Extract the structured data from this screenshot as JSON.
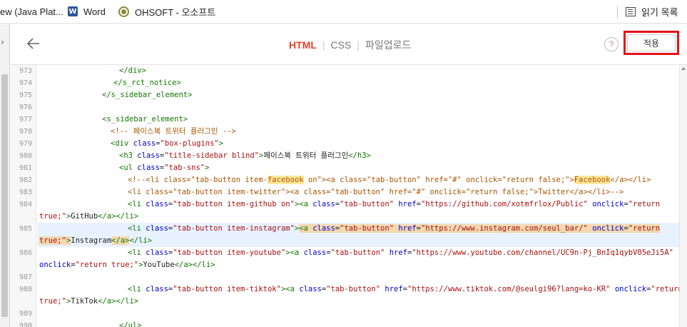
{
  "bookmarks": {
    "items": [
      {
        "label": "ew (Java Plat..."
      },
      {
        "label": "Word",
        "icon": "word-icon"
      },
      {
        "label": "OHSOFT - 오소프트",
        "icon": "ohsoft-icon"
      }
    ],
    "reading_list": "읽기 목록"
  },
  "header": {
    "tabs": [
      {
        "label": "HTML",
        "active": true
      },
      {
        "label": "CSS",
        "active": false
      },
      {
        "label": "파일업로드",
        "active": false
      }
    ],
    "help": "?",
    "apply_label": "적용"
  },
  "editor": {
    "lines": [
      {
        "num": "973",
        "segments": [
          {
            "text": "</div>",
            "cls": "t"
          }
        ]
      },
      {
        "num": "974",
        "segments": [
          {
            "text": "</s_rct_notice>",
            "cls": "t"
          }
        ]
      },
      {
        "num": "975",
        "segments": [
          {
            "text": "</s_sidebar_element>",
            "cls": "t"
          }
        ]
      },
      {
        "num": "976",
        "segments": []
      },
      {
        "num": "977",
        "segments": [
          {
            "text": "<s_sidebar_element>",
            "cls": "t"
          }
        ]
      },
      {
        "num": "978",
        "segments": [
          {
            "text": "<!-- 페이스북 트위터 플러그인 -->",
            "cls": "c"
          }
        ]
      },
      {
        "num": "979",
        "segments": [
          {
            "text": "<div ",
            "cls": "t"
          },
          {
            "text": "class",
            "cls": "a"
          },
          {
            "text": "=",
            "cls": ""
          },
          {
            "text": "\"box-plugins\"",
            "cls": "s"
          },
          {
            "text": ">",
            "cls": "t"
          }
        ]
      },
      {
        "num": "980",
        "segments": [
          {
            "text": "<h3 ",
            "cls": "t"
          },
          {
            "text": "class",
            "cls": "a"
          },
          {
            "text": "=",
            "cls": ""
          },
          {
            "text": "\"title-sidebar blind\"",
            "cls": "s"
          },
          {
            "text": ">",
            "cls": "t"
          },
          {
            "text": "페이스북 트위터 플러그인",
            "cls": ""
          },
          {
            "text": "</h3>",
            "cls": "t"
          }
        ]
      },
      {
        "num": "981",
        "segments": [
          {
            "text": "<ul ",
            "cls": "t"
          },
          {
            "text": "class",
            "cls": "a"
          },
          {
            "text": "=",
            "cls": ""
          },
          {
            "text": "\"tab-sns\"",
            "cls": "s"
          },
          {
            "text": ">",
            "cls": "t"
          }
        ]
      },
      {
        "num": "982",
        "segments": [
          {
            "text": "<!--<li class=\"tab-button item-",
            "cls": "c"
          },
          {
            "text": "facebook",
            "cls": "c m"
          },
          {
            "text": " on\"><a class=\"tab-button\" href=\"#\" onclick=\"return false;\">",
            "cls": "c"
          },
          {
            "text": "Facebook",
            "cls": "c m"
          },
          {
            "text": "</a></li>",
            "cls": "c"
          }
        ]
      },
      {
        "num": "983",
        "segments": [
          {
            "text": "<li class=\"tab-button item-twitter\"><a class=\"tab-button\" href=\"#\" onclick=\"return false;\">Twitter</a></li>-->",
            "cls": "c"
          }
        ]
      },
      {
        "num": "984",
        "segments": [
          {
            "text": "<li ",
            "cls": "t"
          },
          {
            "text": "class",
            "cls": "a"
          },
          {
            "text": "=",
            "cls": ""
          },
          {
            "text": "\"tab-button item-github on\"",
            "cls": "s"
          },
          {
            "text": "><a ",
            "cls": "t"
          },
          {
            "text": "class",
            "cls": "a"
          },
          {
            "text": "=",
            "cls": ""
          },
          {
            "text": "\"tab-button\"",
            "cls": "s"
          },
          {
            "text": " ",
            "cls": ""
          },
          {
            "text": "href",
            "cls": "a"
          },
          {
            "text": "=",
            "cls": ""
          },
          {
            "text": "\"https://github.com/xotmfrlox/Public\"",
            "cls": "s"
          },
          {
            "text": " ",
            "cls": ""
          },
          {
            "text": "onclick",
            "cls": "a"
          },
          {
            "text": "=",
            "cls": ""
          },
          {
            "text": "\"return",
            "cls": "s"
          }
        ]
      },
      {
        "num": "",
        "segments": [
          {
            "text": "true;\"",
            "cls": "s"
          },
          {
            "text": ">",
            "cls": "t"
          },
          {
            "text": "GitHub",
            "cls": ""
          },
          {
            "text": "</a></li>",
            "cls": "t"
          }
        ]
      },
      {
        "num": "985",
        "segments": [
          {
            "text": "<li ",
            "cls": "t"
          },
          {
            "text": "class",
            "cls": "a"
          },
          {
            "text": "=",
            "cls": ""
          },
          {
            "text": "\"tab-button item-instagram\"",
            "cls": "s"
          },
          {
            "text": ">",
            "cls": "t"
          },
          {
            "text": "<a ",
            "cls": "t mb"
          },
          {
            "text": "class",
            "cls": "a mb"
          },
          {
            "text": "=",
            "cls": "mb"
          },
          {
            "text": "\"tab-button\"",
            "cls": "s mb"
          },
          {
            "text": " ",
            "cls": "mb"
          },
          {
            "text": "href",
            "cls": "a mb"
          },
          {
            "text": "=",
            "cls": "mb"
          },
          {
            "text": "\"https://www.instagram.com/seul_bar/\"",
            "cls": "s mb"
          },
          {
            "text": " ",
            "cls": "mb"
          },
          {
            "text": "onclick",
            "cls": "a mb"
          },
          {
            "text": "=",
            "cls": "mb"
          },
          {
            "text": "\"return",
            "cls": "s mb"
          }
        ]
      },
      {
        "num": "",
        "segments": [
          {
            "text": "true;\"",
            "cls": "s mb"
          },
          {
            "text": ">",
            "cls": "t mb"
          },
          {
            "text": "Instagram",
            "cls": ""
          },
          {
            "text": "</a>",
            "cls": "t mb"
          },
          {
            "text": "</li>",
            "cls": "t"
          }
        ]
      },
      {
        "num": "986",
        "segments": [
          {
            "text": "<li ",
            "cls": "t"
          },
          {
            "text": "class",
            "cls": "a"
          },
          {
            "text": "=",
            "cls": ""
          },
          {
            "text": "\"tab-button item-youtube\"",
            "cls": "s"
          },
          {
            "text": "><a ",
            "cls": "t"
          },
          {
            "text": "class",
            "cls": "a"
          },
          {
            "text": "=",
            "cls": ""
          },
          {
            "text": "\"tab-button\"",
            "cls": "s"
          },
          {
            "text": " ",
            "cls": ""
          },
          {
            "text": "href",
            "cls": "a"
          },
          {
            "text": "=",
            "cls": ""
          },
          {
            "text": "\"https://www.youtube.com/channel/UC9n-Pj_BnIq1qybV05eJi5A\"",
            "cls": "s"
          }
        ]
      },
      {
        "num": "",
        "segments": [
          {
            "text": "onclick",
            "cls": "a"
          },
          {
            "text": "=",
            "cls": ""
          },
          {
            "text": "\"return true;\"",
            "cls": "s"
          },
          {
            "text": ">",
            "cls": "t"
          },
          {
            "text": "YouTube",
            "cls": ""
          },
          {
            "text": "</a></li>",
            "cls": "t"
          }
        ]
      },
      {
        "num": "987",
        "segments": []
      },
      {
        "num": "988",
        "segments": [
          {
            "text": "<li ",
            "cls": "t"
          },
          {
            "text": "class",
            "cls": "a"
          },
          {
            "text": "=",
            "cls": ""
          },
          {
            "text": "\"tab-button item-tiktok\"",
            "cls": "s"
          },
          {
            "text": "><a ",
            "cls": "t"
          },
          {
            "text": "class",
            "cls": "a"
          },
          {
            "text": "=",
            "cls": ""
          },
          {
            "text": "\"tab-button\"",
            "cls": "s"
          },
          {
            "text": " ",
            "cls": ""
          },
          {
            "text": "href",
            "cls": "a"
          },
          {
            "text": "=",
            "cls": ""
          },
          {
            "text": "\"https://www.tiktok.com/@seulgi96?lang=ko-KR\"",
            "cls": "s"
          },
          {
            "text": " ",
            "cls": ""
          },
          {
            "text": "onclick",
            "cls": "a"
          },
          {
            "text": "=",
            "cls": ""
          },
          {
            "text": "\"return",
            "cls": "s"
          }
        ]
      },
      {
        "num": "",
        "segments": [
          {
            "text": "true;\"",
            "cls": "s"
          },
          {
            "text": ">",
            "cls": "t"
          },
          {
            "text": "TikTok",
            "cls": ""
          },
          {
            "text": "</a></li>",
            "cls": "t"
          }
        ]
      },
      {
        "num": "989",
        "segments": []
      },
      {
        "num": "990",
        "segments": [
          {
            "text": "</ul>",
            "cls": "t"
          }
        ]
      }
    ]
  }
}
